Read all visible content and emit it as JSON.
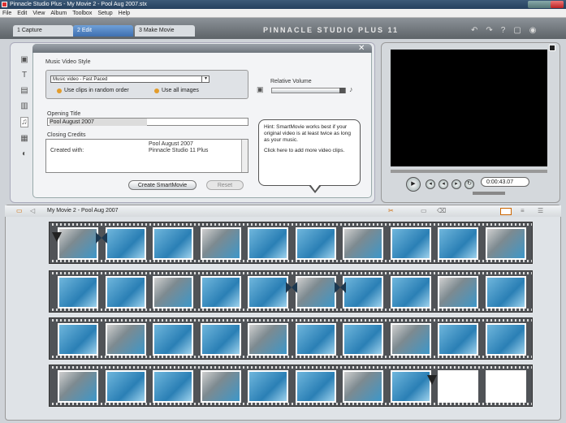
{
  "window": {
    "title": "Pinnacle Studio Plus - My Movie 2 - Pool Aug 2007.stx"
  },
  "menu": [
    "File",
    "Edit",
    "View",
    "Album",
    "Toolbox",
    "Setup",
    "Help"
  ],
  "tabs": [
    "1 Capture",
    "2 Edit",
    "3 Make Movie"
  ],
  "brand": "PINNACLE STUDIO PLUS 11",
  "editor": {
    "section_label": "Music Video Style",
    "style_value": "Music video - Fast Paced",
    "option1": "Use clips in random order",
    "option2": "Use all images",
    "volume_label": "Relative Volume",
    "opening_title_label": "Opening Title",
    "opening_title_value": "Pool August 2007",
    "closing_credits_label": "Closing Credits",
    "credits_left": "Created with:",
    "credits_right_1": "Pool August 2007",
    "credits_right_2": "Pinnacle Studio 11 Plus",
    "create_button": "Create SmartMovie",
    "reset_button": "Reset",
    "hint_1": "Hint: SmartMovie works best if your original video is at least twice as long as your music.",
    "hint_2": "Click here to add more video clips."
  },
  "player": {
    "timecode": "0:00:43.07"
  },
  "timeline": {
    "title": "My Movie 2 - Pool Aug 2007"
  }
}
